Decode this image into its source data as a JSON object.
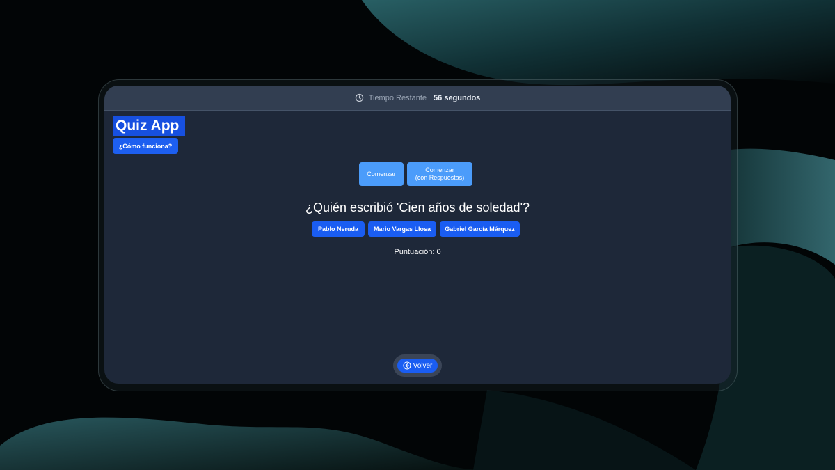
{
  "timer": {
    "label": "Tiempo Restante",
    "value": "56 segundos",
    "icon": "clock-icon"
  },
  "app": {
    "title": "Quiz App",
    "help_label": "¿Cómo funciona?"
  },
  "start": {
    "label": "Comenzar",
    "with_answers_line1": "Comenzar",
    "with_answers_line2": "(con Respuestas)"
  },
  "question": {
    "text": "¿Quién escribió 'Cien años de soledad'?"
  },
  "answers": [
    "Pablo Neruda",
    "Mario Vargas Llosa",
    "Gabriel García Márquez"
  ],
  "score": {
    "text": "Puntuación: 0"
  },
  "back": {
    "label": "Volver",
    "icon": "arrow-left-circle-icon"
  },
  "colors": {
    "window_bg": "#1e2839",
    "topbar_bg": "#323e51",
    "primary_button": "#1a5df2",
    "light_button": "#4b9cfa",
    "title_highlight": "#1750e0"
  }
}
